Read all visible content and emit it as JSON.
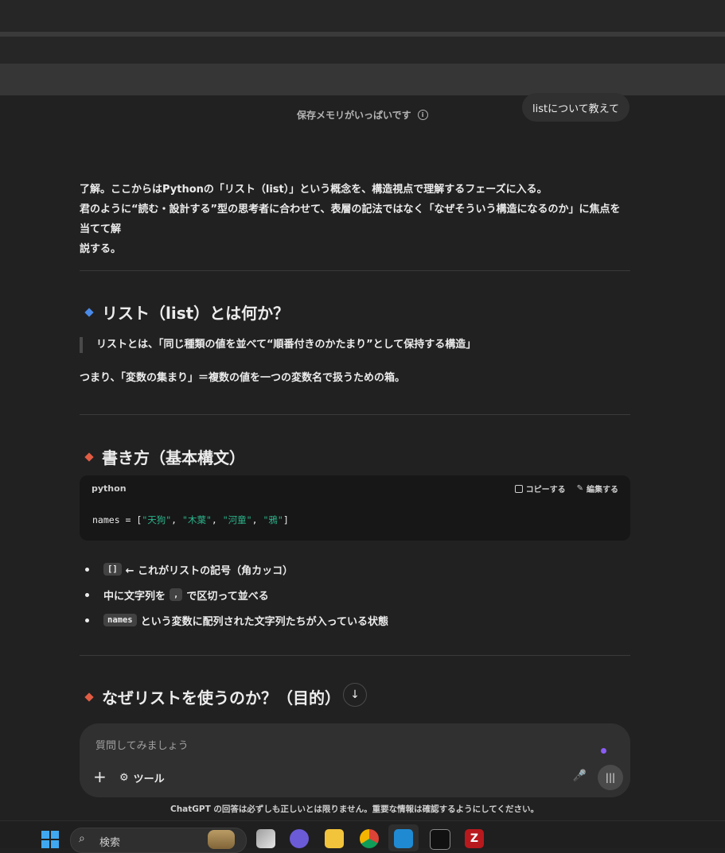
{
  "banner": {
    "memory_full": "保存メモリがいっぱいです"
  },
  "user_message": "listについて教えて",
  "intro": {
    "line1": "了解。ここからはPythonの「リスト（list）」という概念を、構造視点で理解するフェーズに入る。",
    "line2": "君のように“読む・設計する”型の思考者に合わせて、表層の記法ではなく「なぜそういう構造になるのか」に焦点を当てて解",
    "line3": "説する。"
  },
  "section1": {
    "heading": "リスト（list）とは何か？",
    "quote": "リストとは、「同じ種類の値を並べて“順番付きのかたまり”として保持する構造」",
    "summary": "つまり、「変数の集まり」＝複数の値を一つの変数名で扱うための箱。"
  },
  "section2": {
    "heading": "書き方（基本構文）",
    "code": {
      "language": "python",
      "copy_label": "コピーする",
      "edit_label": "編集する",
      "prefix": "names = [",
      "items": [
        "\"天狗\"",
        "\"木葉\"",
        "\"河童\"",
        "\"鴉\""
      ],
      "separator": ", ",
      "suffix": "]"
    },
    "bullets": [
      {
        "code": "[]",
        "text": "← これがリストの記号（角カッコ）"
      },
      {
        "pre": "中に文字列を",
        "code": ",",
        "text": "で区切って並べる"
      },
      {
        "code": "names",
        "text": "という変数に配列された文字列たちが入っている状態"
      }
    ]
  },
  "section3": {
    "heading": "なぜリストを使うのか？（目的）"
  },
  "composer": {
    "placeholder": "質問してみましょう",
    "tools_label": "ツール"
  },
  "disclaimer": "ChatGPT の回答は必ずしも正しいとは限りません。重要な情報は確認するようにしてください。",
  "taskbar": {
    "search_label": "検索"
  },
  "colors": {
    "accent_purple": "#8b5cf6",
    "code_string": "#2bb38a",
    "diamond_blue": "#4a8ae8",
    "diamond_red": "#e05d44"
  }
}
